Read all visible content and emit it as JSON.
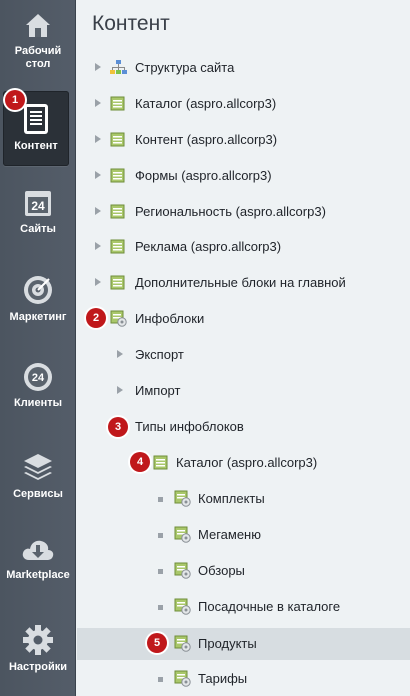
{
  "sidebar": {
    "items": [
      {
        "label": "Рабочий стол",
        "icon": "home-icon"
      },
      {
        "label": "Контент",
        "icon": "document-icon",
        "active": true
      },
      {
        "label": "Сайты",
        "icon": "calendar-24-icon"
      },
      {
        "label": "Маркетинг",
        "icon": "target-icon"
      },
      {
        "label": "Клиенты",
        "icon": "clients-24-icon"
      },
      {
        "label": "Сервисы",
        "icon": "layers-icon"
      },
      {
        "label": "Marketplace",
        "icon": "cloud-download-icon"
      },
      {
        "label": "Настройки",
        "icon": "gear-icon"
      }
    ]
  },
  "badges": [
    "1",
    "2",
    "3",
    "4",
    "5"
  ],
  "main": {
    "title": "Контент",
    "tree": [
      {
        "label": "Структура сайта",
        "icon": "site-structure-icon",
        "marker": "arrow"
      },
      {
        "label": "Каталог (aspro.allcorp3)",
        "icon": "iblock-icon",
        "marker": "arrow"
      },
      {
        "label": "Контент (aspro.allcorp3)",
        "icon": "iblock-icon",
        "marker": "arrow"
      },
      {
        "label": "Формы (aspro.allcorp3)",
        "icon": "iblock-icon",
        "marker": "arrow"
      },
      {
        "label": "Региональность (aspro.allcorp3)",
        "icon": "iblock-icon",
        "marker": "arrow"
      },
      {
        "label": "Реклама (aspro.allcorp3)",
        "icon": "iblock-icon",
        "marker": "arrow"
      },
      {
        "label": "Дополнительные блоки на главной",
        "icon": "iblock-icon",
        "marker": "arrow"
      },
      {
        "label": "Инфоблоки",
        "icon": "iblock-gear-icon",
        "marker": "none"
      },
      {
        "label": "Экспорт",
        "icon": "",
        "marker": "arrow"
      },
      {
        "label": "Импорт",
        "icon": "",
        "marker": "arrow"
      },
      {
        "label": "Типы инфоблоков",
        "icon": "",
        "marker": "none"
      },
      {
        "label": "Каталог (aspro.allcorp3)",
        "icon": "iblock-icon",
        "marker": "none"
      },
      {
        "label": "Комплекты",
        "icon": "iblock-gear-icon",
        "marker": "bullet"
      },
      {
        "label": "Мегаменю",
        "icon": "iblock-gear-icon",
        "marker": "bullet"
      },
      {
        "label": "Обзоры",
        "icon": "iblock-gear-icon",
        "marker": "bullet"
      },
      {
        "label": "Посадочные в каталоге",
        "icon": "iblock-gear-icon",
        "marker": "bullet"
      },
      {
        "label": "Продукты",
        "icon": "iblock-gear-icon",
        "marker": "bullet",
        "selected": true
      },
      {
        "label": "Тарифы",
        "icon": "iblock-gear-icon",
        "marker": "bullet"
      }
    ]
  }
}
